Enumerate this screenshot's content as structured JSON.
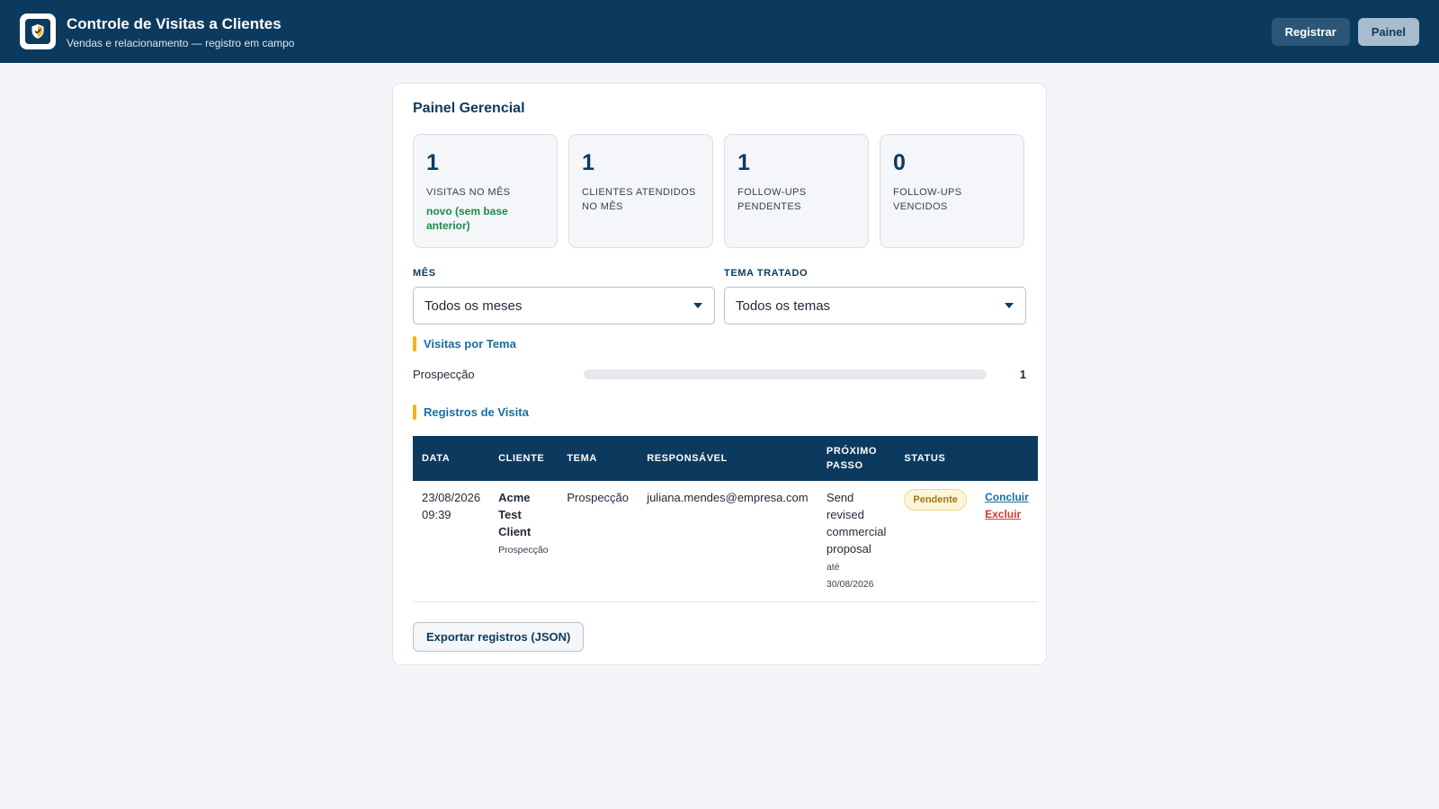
{
  "app": {
    "title": "Controle de Visitas a Clientes",
    "subtitle": "Vendas e relacionamento — registro em campo",
    "logo_icon": "shield-check-icon",
    "nav": {
      "registrar": "Registrar",
      "painel": "Painel"
    }
  },
  "panel": {
    "title": "Painel Gerencial",
    "stats": [
      {
        "value": "1",
        "label": "VISITAS NO MÊS",
        "trend": "novo (sem base anterior)"
      },
      {
        "value": "1",
        "label": "CLIENTES ATENDIDOS NO MÊS"
      },
      {
        "value": "1",
        "label": "FOLLOW-UPS PENDENTES"
      },
      {
        "value": "0",
        "label": "FOLLOW-UPS VENCIDOS"
      }
    ],
    "filters": {
      "month": {
        "label": "MÊS",
        "value": "Todos os meses"
      },
      "theme": {
        "label": "TEMA TRATADO",
        "value": "Todos os temas"
      }
    },
    "by_theme": {
      "title": "Visitas por Tema",
      "items": [
        {
          "label": "Prospecção",
          "value": "1",
          "fraction": 0
        }
      ]
    },
    "records": {
      "title": "Registros de Visita",
      "columns": [
        "DATA",
        "CLIENTE",
        "TEMA",
        "RESPONSÁVEL",
        "PRÓXIMO PASSO",
        "STATUS"
      ],
      "rows": [
        {
          "date": "23/08/2026",
          "time": "09:39",
          "client": "Acme Test Client",
          "client_theme": "Prospecção",
          "theme": "Prospecção",
          "owner": "juliana.mendes@empresa.com",
          "next_step": "Send revised commercial proposal",
          "due": "até 30/08/2026",
          "status": "Pendente",
          "action_complete": "Concluir",
          "action_delete": "Excluir"
        }
      ]
    },
    "export_label": "Exportar registros (JSON)"
  },
  "colors": {
    "header": "#0c3a5e",
    "accent": "#f5b21a",
    "link": "#1b6da3",
    "trend_positive": "#1f8a47",
    "danger": "#d03a2e",
    "pending_badge": "#fdf5d8"
  }
}
